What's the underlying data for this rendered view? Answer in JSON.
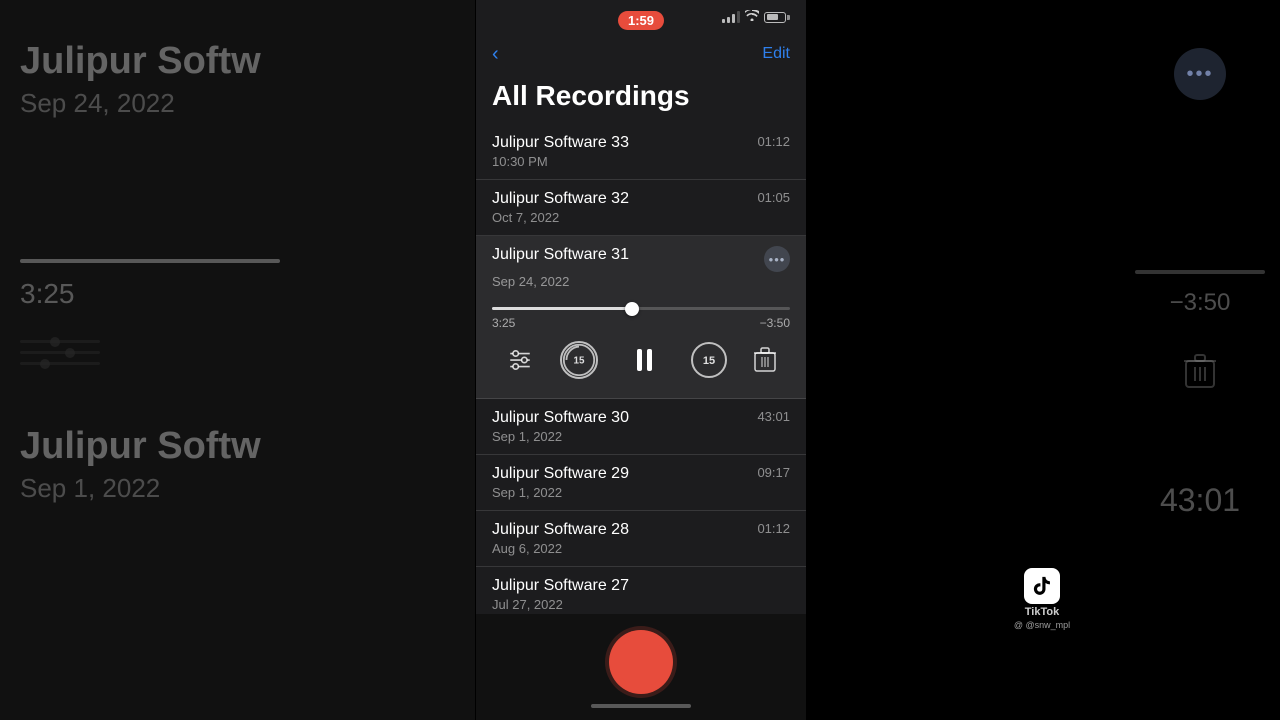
{
  "statusBar": {
    "time": "1:59",
    "signalBars": 3,
    "wifiLabel": "wifi",
    "batteryLevel": "65%"
  },
  "nav": {
    "backLabel": "‹",
    "editLabel": "Edit"
  },
  "pageTitle": "All Recordings",
  "recordings": [
    {
      "id": "33",
      "name": "Julipur Software 33",
      "date": "10:30 PM",
      "duration": "01:12",
      "active": false
    },
    {
      "id": "32",
      "name": "Julipur Software 32",
      "date": "Oct 7, 2022",
      "duration": "01:05",
      "active": false
    },
    {
      "id": "31",
      "name": "Julipur Software 31",
      "date": "Sep 24, 2022",
      "duration": "",
      "active": true,
      "currentTime": "3:25",
      "remainingTime": "−3:50",
      "progressPercent": 47
    },
    {
      "id": "30",
      "name": "Julipur Software 30",
      "date": "Sep 1, 2022",
      "duration": "43:01",
      "active": false
    },
    {
      "id": "29",
      "name": "Julipur Software 29",
      "date": "Sep 1, 2022",
      "duration": "09:17",
      "active": false
    },
    {
      "id": "28",
      "name": "Julipur Software 28",
      "date": "Aug 6, 2022",
      "duration": "01:12",
      "active": false
    },
    {
      "id": "27",
      "name": "Julipur Software 27",
      "date": "Jul 27, 2022",
      "duration": "",
      "active": false
    }
  ],
  "player": {
    "skipBackLabel": "15",
    "skipForwardLabel": "15",
    "settingsIcon": "settings-icon",
    "pauseIcon": "pause-icon",
    "trashIcon": "trash-icon"
  },
  "recordButton": {
    "label": "Record"
  },
  "bgLeft": {
    "title1": "Julipur Softw",
    "date1": "Sep 24, 2022",
    "time1": "3:25",
    "title2": "Julipur Softw",
    "date2": "Sep 1, 2022"
  },
  "bgRight": {
    "timeRight": "−3:50",
    "durationRight": "43:01"
  },
  "tiktok": {
    "logoText": "♪",
    "brandName": "TikTok",
    "username": "@ @snw_mpl"
  }
}
